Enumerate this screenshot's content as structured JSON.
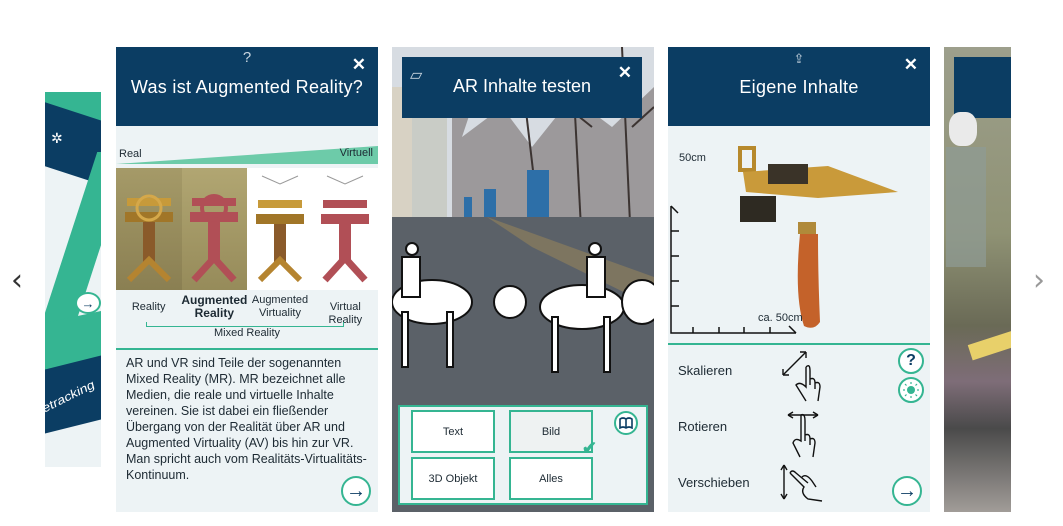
{
  "navigation": {
    "prev_icon": "‹",
    "next_icon": "›"
  },
  "slide_left": {
    "partial_text": "etracking",
    "icon": "tracking-target-icon",
    "arrow": "→"
  },
  "slide_ar_intro": {
    "title": "Was ist Augmented Reality?",
    "help_icon": "?",
    "close_icon": "✕",
    "scale": {
      "left_label": "Real",
      "right_label": "Virtuell"
    },
    "spectrum": [
      {
        "label": "Reality",
        "bold": false
      },
      {
        "label": "Augmented Reality",
        "bold": true
      },
      {
        "label": "Augmented Virtuality",
        "bold": false
      },
      {
        "label": "Virtual Reality",
        "bold": false
      }
    ],
    "spectrum_labels": {
      "reality": "Reality",
      "ar_line1": "Augmented",
      "ar_line2": "Reality",
      "av_line1": "Augmented",
      "av_line2": "Virtuality",
      "vr": "Virtual Reality"
    },
    "mixed_reality_label": "Mixed Reality",
    "body": "AR und VR sind Teile der sogenannten Mixed Reality (MR). MR bezeichnet alle Medien, die reale und virtuelle Inhalte vereinen. Sie ist dabei ein fließender Übergang von der Realität über AR und Augmented Virtuality (AV) bis hin zur VR. Man spricht auch vom Realitäts-Virtualitäts-Kontinuum.",
    "next_arrow": "→"
  },
  "slide_ar_test": {
    "title": "AR Inhalte testen",
    "close_icon": "✕",
    "header_icon": "ar-marker-icon",
    "filters": [
      {
        "label": "Text",
        "selected": false
      },
      {
        "label": "Bild",
        "selected": true
      },
      {
        "label": "3D Objekt",
        "selected": false
      },
      {
        "label": "Alles",
        "selected": false
      }
    ],
    "check_icon": "✔",
    "book_icon": "book-icon"
  },
  "slide_own_content": {
    "title": "Eigene Inhalte",
    "close_icon": "✕",
    "share_icon": "⇪",
    "axis_vertical_label": "50cm",
    "axis_horizontal_label": "ca. 50cm",
    "gestures": [
      {
        "label": "Skalieren",
        "icon": "pinch-scale-gesture-icon"
      },
      {
        "label": "Rotieren",
        "icon": "rotate-gesture-icon"
      },
      {
        "label": "Verschieben",
        "icon": "drag-move-gesture-icon"
      }
    ],
    "help_icon": "?",
    "light_icon": "light-icon",
    "next_arrow": "→"
  },
  "colors": {
    "header_blue": "#0b3d63",
    "accent_green": "#35b592",
    "panel_bg": "#edf3f5"
  }
}
